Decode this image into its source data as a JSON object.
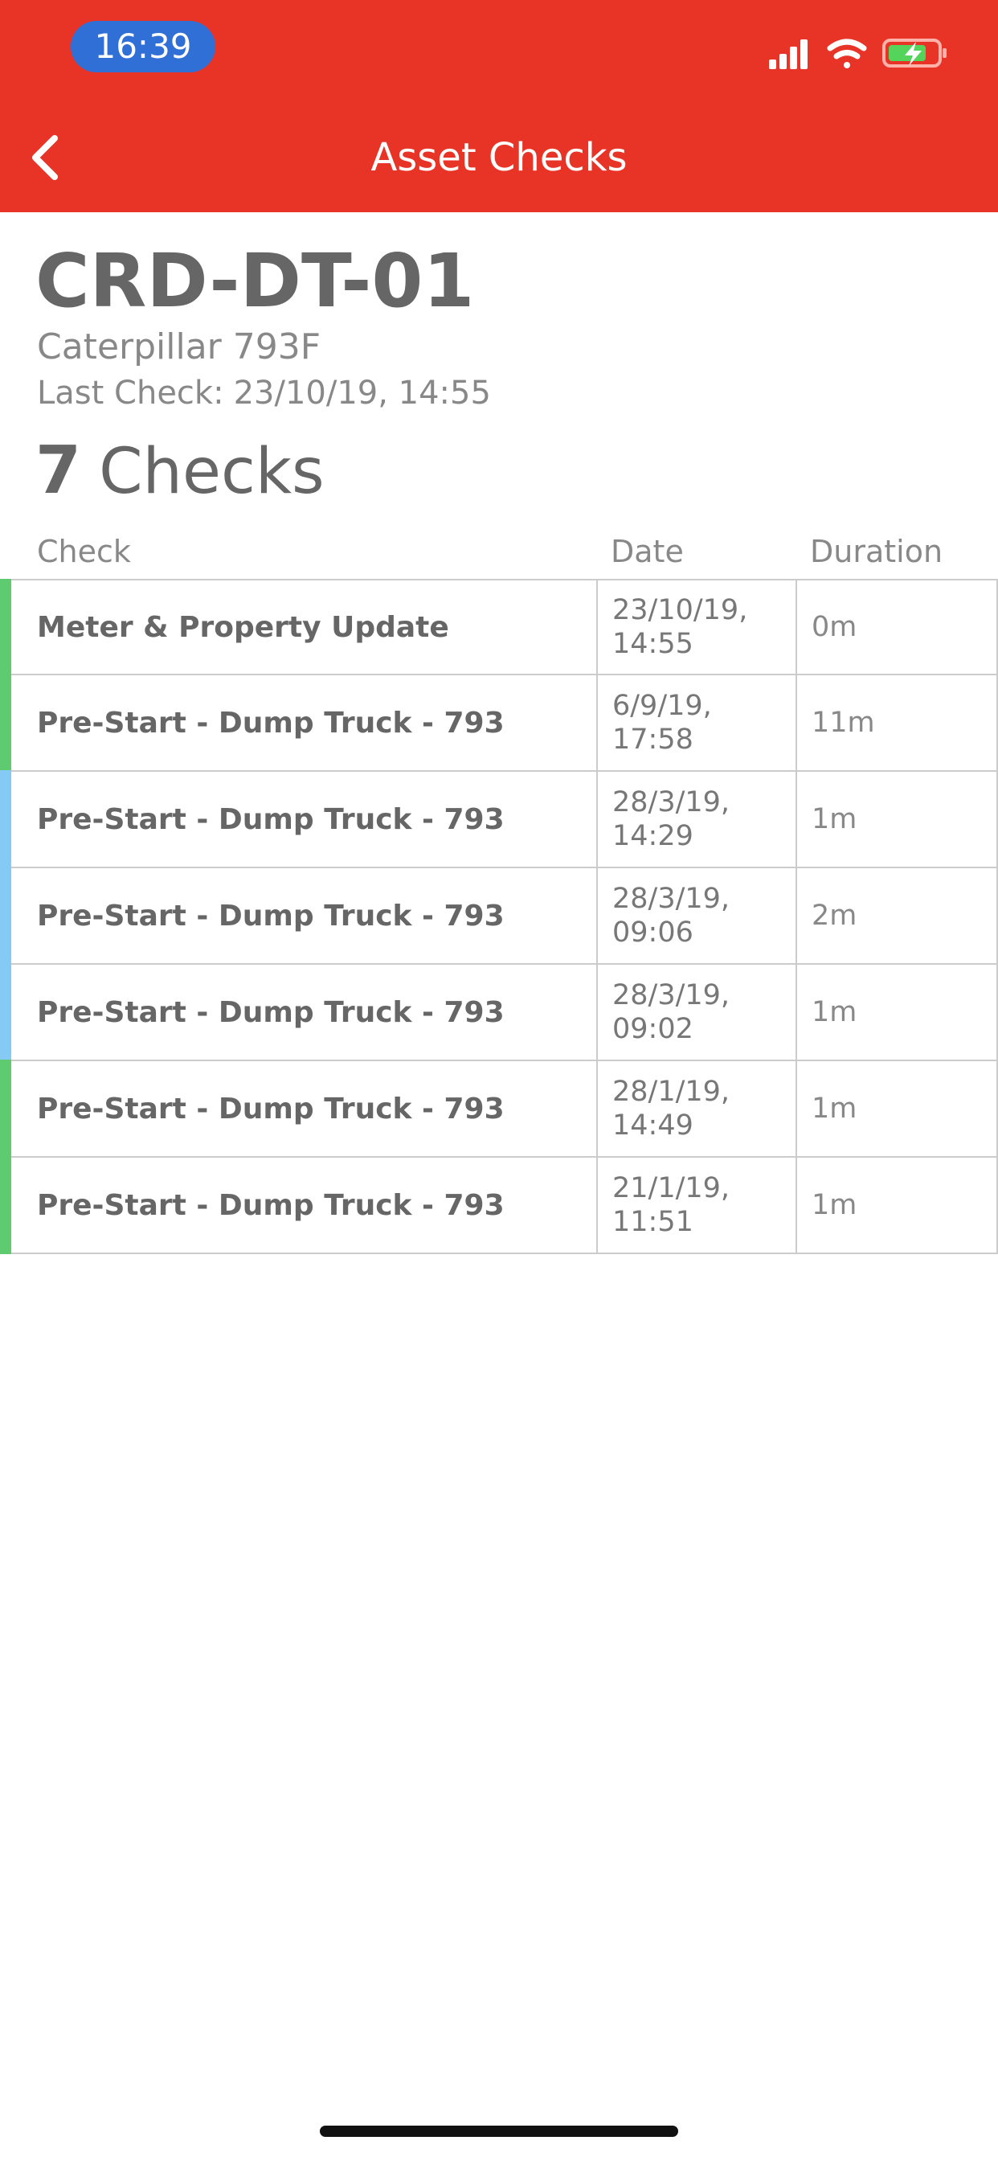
{
  "status_bar": {
    "time": "16:39",
    "icons": [
      "cellular-signal-icon",
      "wifi-icon",
      "battery-charging-icon"
    ]
  },
  "nav": {
    "title": "Asset Checks",
    "back_icon": "chevron-left-icon"
  },
  "asset": {
    "id": "CRD-DT-01",
    "model": "Caterpillar 793F",
    "last_check_label": "Last Check:",
    "last_check_value": "23/10/19, 14:55"
  },
  "summary": {
    "count": "7",
    "label": "Checks"
  },
  "table": {
    "headers": {
      "check": "Check",
      "date": "Date",
      "duration": "Duration"
    },
    "rows": [
      {
        "check": "Meter & Property Update",
        "date": "23/10/19, 14:55",
        "duration": "0m",
        "status_color": "#5ecb70"
      },
      {
        "check": "Pre-Start - Dump Truck - 793",
        "date": "6/9/19, 17:58",
        "duration": "11m",
        "status_color": "#5ecb70"
      },
      {
        "check": "Pre-Start - Dump Truck - 793",
        "date": "28/3/19, 14:29",
        "duration": "1m",
        "status_color": "#85c9f5"
      },
      {
        "check": "Pre-Start - Dump Truck - 793",
        "date": "28/3/19, 09:06",
        "duration": "2m",
        "status_color": "#85c9f5"
      },
      {
        "check": "Pre-Start - Dump Truck - 793",
        "date": "28/3/19, 09:02",
        "duration": "1m",
        "status_color": "#85c9f5"
      },
      {
        "check": "Pre-Start - Dump Truck - 793",
        "date": "28/1/19, 14:49",
        "duration": "1m",
        "status_color": "#5ecb70"
      },
      {
        "check": "Pre-Start - Dump Truck - 793",
        "date": "21/1/19, 11:51",
        "duration": "1m",
        "status_color": "#5ecb70"
      }
    ]
  },
  "colors": {
    "header_bg": "#e83427",
    "time_pill": "#2f6fd6",
    "text_dark": "#666666",
    "text_light": "#888888",
    "status_green": "#5ecb70",
    "status_blue": "#85c9f5"
  }
}
